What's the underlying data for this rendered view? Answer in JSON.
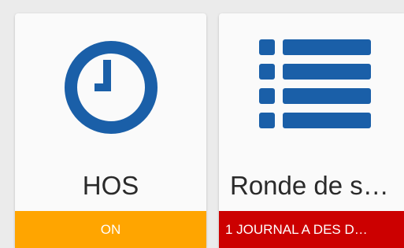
{
  "colors": {
    "icon_blue": "#1a5fa8",
    "status_on": "#ffa500",
    "status_alert": "#cc0000",
    "background": "#ebebeb"
  },
  "tiles": [
    {
      "icon": "clock-icon",
      "title": "HOS",
      "status": "ON"
    },
    {
      "icon": "list-icon",
      "title": "Ronde de s…",
      "status": "1 JOURNAL A DES D…"
    }
  ]
}
